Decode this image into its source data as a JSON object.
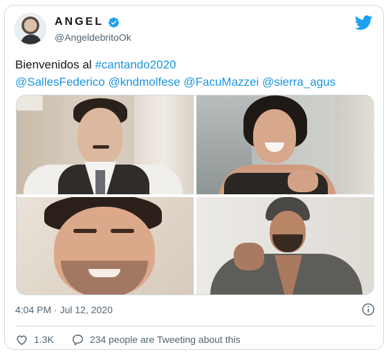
{
  "author": {
    "display_name": "ANGEL",
    "handle": "@AngeldebritoOk",
    "verified": true,
    "avatar_icon": "profile-photo"
  },
  "tweet": {
    "line1_prefix": "Bienvenidos al ",
    "hashtag": "#cantando2020",
    "mentions": [
      "@SallesFederico",
      "@kndmolfese",
      "@FacuMazzei",
      "@sierra_agus"
    ],
    "photos": [
      "photo-man-mustache-vest",
      "photo-woman-laughing",
      "photo-man-smiling-closeup",
      "photo-man-beanie-jacket"
    ]
  },
  "meta": {
    "timestamp": "4:04 PM · Jul 12, 2020",
    "info_icon": "info-icon"
  },
  "actions": {
    "likes": "1.3K",
    "conversation": "234 people are Tweeting about this"
  },
  "colors": {
    "link": "#1b95e0",
    "twitter_blue": "#1da1f2",
    "secondary_text": "#536471",
    "border": "#cfd9de"
  }
}
